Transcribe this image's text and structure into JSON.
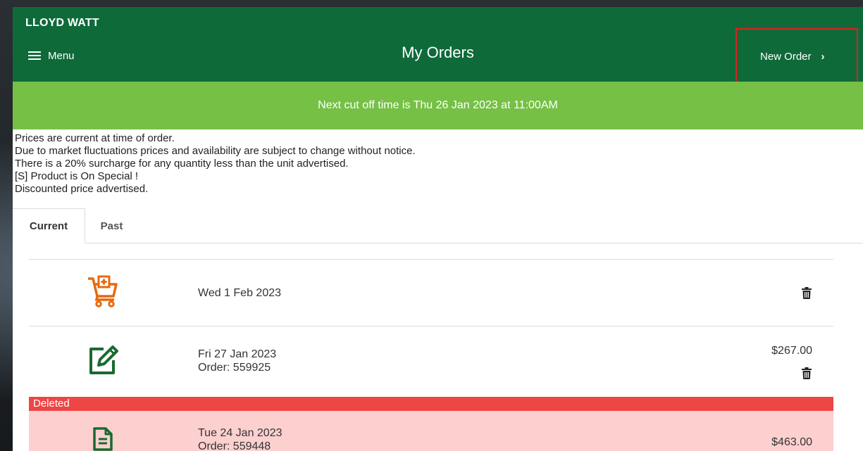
{
  "header": {
    "user_name": "LLOYD WATT",
    "menu_label": "Menu",
    "title": "My Orders",
    "new_order_label": "New Order"
  },
  "cutoff_message": "Next cut off time is Thu 26 Jan 2023 at 11:00AM",
  "notices": [
    "Prices are current at time of order.",
    "Due to market fluctuations prices and availability are subject to change without notice.",
    "There is a 20% surcharge for any quantity less than the unit advertised.",
    "[S] Product is On Special !",
    "Discounted price advertised."
  ],
  "tabs": [
    {
      "label": "Current",
      "active": true
    },
    {
      "label": "Past",
      "active": false
    }
  ],
  "orders": [
    {
      "icon": "cart-add-icon",
      "date": "Wed 1 Feb 2023",
      "order": "",
      "price": ""
    },
    {
      "icon": "edit-icon",
      "date": "Fri 27 Jan 2023",
      "order": "Order: 559925",
      "price": "$267.00"
    },
    {
      "icon": "document-icon",
      "status": "Deleted",
      "date": "Tue 24 Jan 2023",
      "order": "Order: 559448",
      "price": "$463.00"
    }
  ],
  "colors": {
    "header_green": "#0f6a3a",
    "cutoff_green": "#75c045",
    "cart_orange": "#e8690f",
    "edit_green": "#1a6a2e",
    "deleted_red": "#ee4545",
    "deleted_row": "#fdd0d0",
    "highlight_box": "#e0201c"
  }
}
